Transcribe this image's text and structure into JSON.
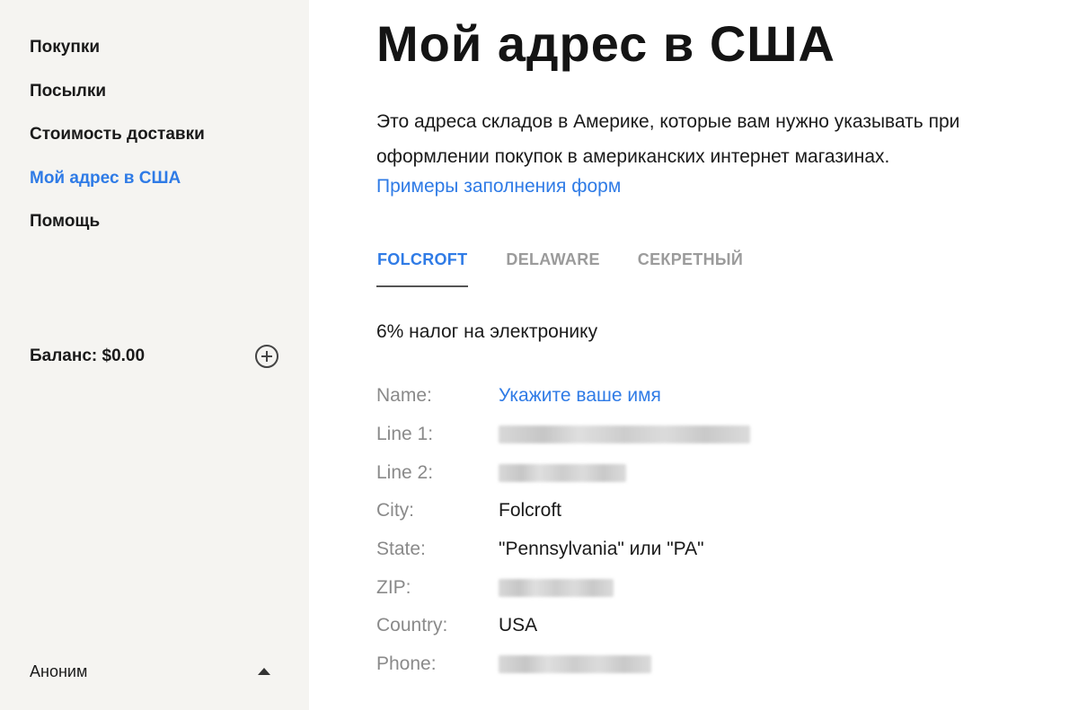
{
  "sidebar": {
    "nav": [
      {
        "label": "Покупки",
        "active": false
      },
      {
        "label": "Посылки",
        "active": false
      },
      {
        "label": "Стоимость доставки",
        "active": false
      },
      {
        "label": "Мой адрес в США",
        "active": true
      },
      {
        "label": "Помощь",
        "active": false
      }
    ],
    "balance_label": "Баланс: $0.00",
    "add_icon": "plus-circle-icon",
    "user_name": "Аноним",
    "user_menu_icon": "caret-up-icon"
  },
  "main": {
    "title": "Мой адрес в США",
    "intro": "Это адреса складов в Америке, которые вам нужно указывать при оформлении покупок в американских интернет магазинах.",
    "examples_link": "Примеры заполнения форм",
    "tabs": [
      {
        "label": "FOLCROFT",
        "active": true
      },
      {
        "label": "DELAWARE",
        "active": false
      },
      {
        "label": "СЕКРЕТНЫЙ",
        "active": false
      }
    ],
    "tax_note": "6% налог на электронику",
    "address": {
      "name_label": "Name:",
      "name_value": "Укажите ваше имя",
      "line1_label": "Line 1:",
      "line1_value": "",
      "line2_label": "Line 2:",
      "line2_value": "",
      "city_label": "City:",
      "city_value": "Folcroft",
      "state_label": "State:",
      "state_value": "\"Pennsylvania\" или \"PA\"",
      "zip_label": "ZIP:",
      "zip_value": "",
      "country_label": "Country:",
      "country_value": "USA",
      "phone_label": "Phone:",
      "phone_value": ""
    }
  },
  "colors": {
    "accent": "#2f7be6",
    "sidebar_bg": "#f5f4f1",
    "muted_label": "#8a8a8a"
  }
}
